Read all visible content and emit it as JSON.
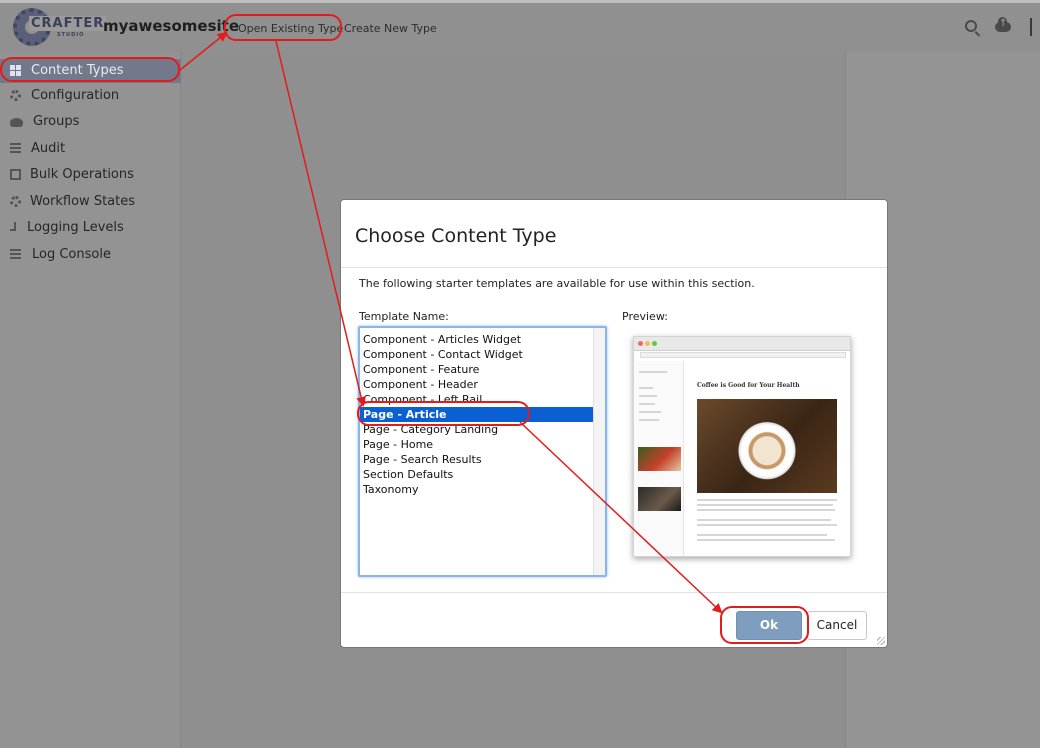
{
  "header": {
    "logo_text": "CRAFTER",
    "logo_sub": "STUDIO",
    "site_name": "myawesomesite",
    "nav": {
      "open_existing": "Open Existing Type",
      "create_new": "Create New Type"
    },
    "icons": [
      "search-icon",
      "cloud-upload-icon"
    ]
  },
  "sidebar": {
    "items": [
      {
        "label": "Content Types",
        "icon": "grid-icon",
        "active": true
      },
      {
        "label": "Configuration",
        "icon": "cog-icon"
      },
      {
        "label": "Groups",
        "icon": "users-icon"
      },
      {
        "label": "Audit",
        "icon": "list-icon"
      },
      {
        "label": "Bulk Operations",
        "icon": "arrows-icon"
      },
      {
        "label": "Workflow States",
        "icon": "cog-icon"
      },
      {
        "label": "Logging Levels",
        "icon": "level-icon"
      },
      {
        "label": "Log Console",
        "icon": "list-icon"
      }
    ]
  },
  "modal": {
    "title": "Choose Content Type",
    "description": "The following starter templates are available for use within this section.",
    "template_label": "Template Name:",
    "preview_label": "Preview:",
    "templates": [
      "Component - Articles Widget",
      "Component - Contact Widget",
      "Component - Feature",
      "Component - Header",
      "Component - Left Rail",
      "Page - Article",
      "Page - Category Landing",
      "Page - Home",
      "Page - Search Results",
      "Section Defaults",
      "Taxonomy"
    ],
    "selected_template": "Page - Article",
    "preview": {
      "heading": "Coffee is Good for Your Health"
    },
    "ok_label": "Ok",
    "cancel_label": "Cancel"
  },
  "colors": {
    "annotation": "#e21c1c",
    "selected_row": "#0a5fd3",
    "ok_button": "#7f9dbf",
    "active_sidebar": "#73798b"
  }
}
